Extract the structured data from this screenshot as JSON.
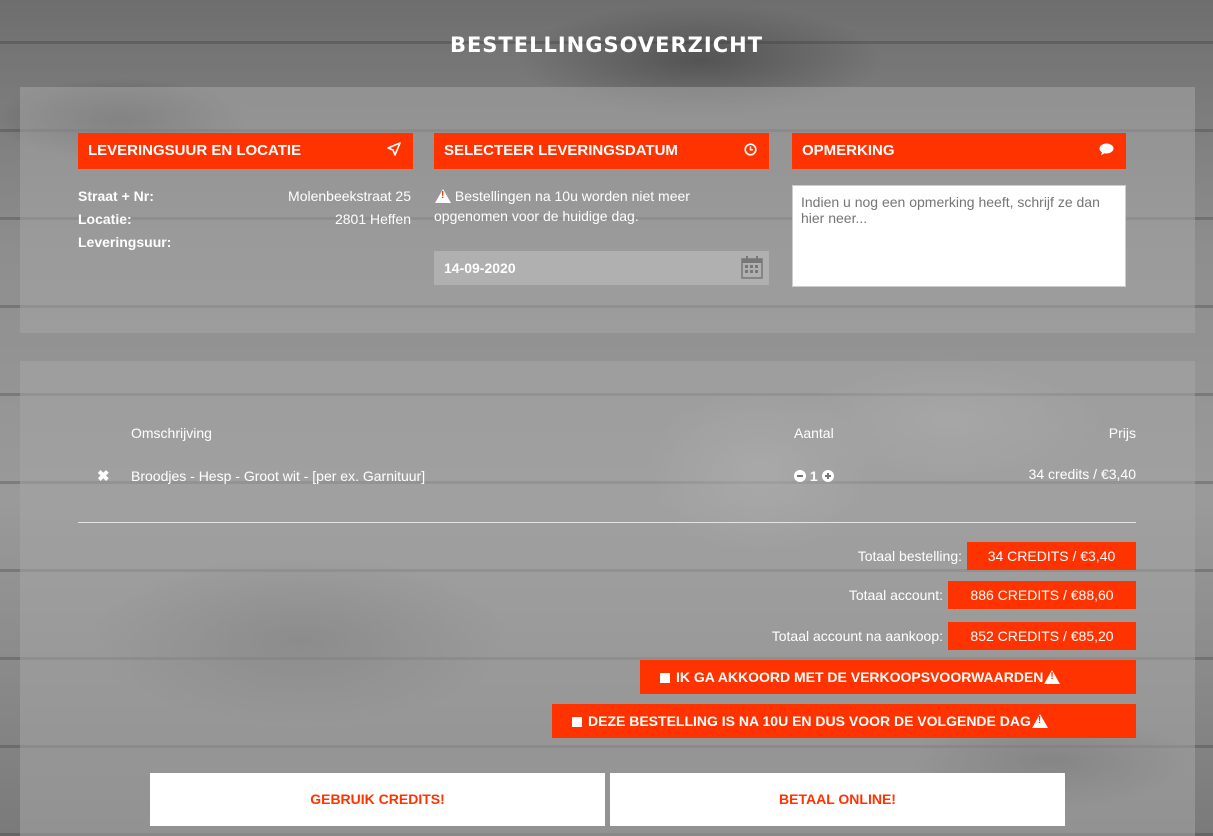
{
  "page": {
    "title": "BESTELLINGSOVERZICHT"
  },
  "delivery": {
    "header": "LEVERINGSUUR EN LOCATIE",
    "icon": "send-icon",
    "street_label": "Straat + Nr:",
    "street_value": "Molenbeekstraat 25",
    "location_label": "Locatie:",
    "location_value": "2801 Heffen",
    "time_label": "Leveringsuur:",
    "time_value": ""
  },
  "date": {
    "header": "SELECTEER LEVERINGSDATUM",
    "icon": "clock-icon",
    "notice": "Bestellingen na 10u worden niet meer opgenomen voor de huidige dag.",
    "value": "14-09-2020"
  },
  "remark": {
    "header": "OPMERKING",
    "icon": "comment-icon",
    "placeholder": "Indien u nog een opmerking heeft, schrijf ze dan hier neer..."
  },
  "order": {
    "columns": {
      "description": "Omschrijving",
      "quantity": "Aantal",
      "price": "Prijs"
    },
    "items": [
      {
        "description": "Broodjes - Hesp - Groot wit - [per ex. Garnituur]",
        "quantity": "1",
        "price": "34 credits / €3,40"
      }
    ]
  },
  "totals": {
    "order_label": "Totaal bestelling:",
    "order_value": "34 CREDITS / €3,40",
    "account_label": "Totaal account:",
    "account_value": "886 CREDITS / €88,60",
    "after_label": "Totaal account na aankoop:",
    "after_value": "852 CREDITS / €85,20"
  },
  "checks": {
    "terms": "IK GA AKKOORD MET DE VERKOOPSVOORWAARDEN",
    "next_day": "DEZE BESTELLING IS NA 10U EN DUS VOOR DE VOLGENDE DAG"
  },
  "actions": {
    "credits": "GEBRUIK CREDITS!",
    "online": "BETAAL ONLINE!"
  },
  "colors": {
    "accent": "#ff3300",
    "panel": "#a5a5a5"
  }
}
